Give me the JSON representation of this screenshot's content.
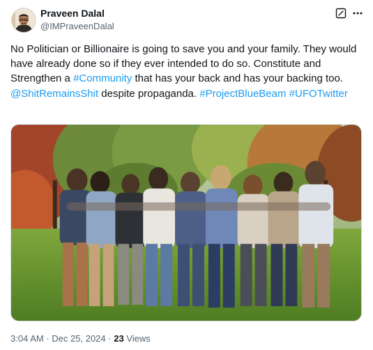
{
  "author": {
    "name": "Praveen Dalal",
    "handle": "@IMPraveenDalal"
  },
  "icons": {
    "edit": "edit-icon",
    "more": "more-icon",
    "avatar": "avatar-photo"
  },
  "tweet": {
    "text_parts": [
      {
        "type": "text",
        "value": "No Politician or Billionaire is going to save you and your family. They would have already done so if they ever intended to do so. Constitute and Strengthen a "
      },
      {
        "type": "link",
        "value": "#Community"
      },
      {
        "type": "text",
        "value": " that has your back and has your backing too. "
      },
      {
        "type": "link",
        "value": "@ShitRemainsShit"
      },
      {
        "type": "text",
        "value": " despite propaganda. "
      },
      {
        "type": "link",
        "value": "#ProjectBlueBeam"
      },
      {
        "type": "text",
        "value": " "
      },
      {
        "type": "link",
        "value": "#UFOTwitter"
      }
    ],
    "image_alt": "Group of friends standing arm in arm on a grassy field facing trees"
  },
  "meta": {
    "time": "3:04 AM",
    "separator": "·",
    "date": "Dec 25, 2024",
    "views_count": "23",
    "views_label": "Views"
  },
  "colors": {
    "link": "#1d9bf0",
    "text": "#0f1419",
    "secondary": "#536471",
    "border": "#cfd9de"
  }
}
